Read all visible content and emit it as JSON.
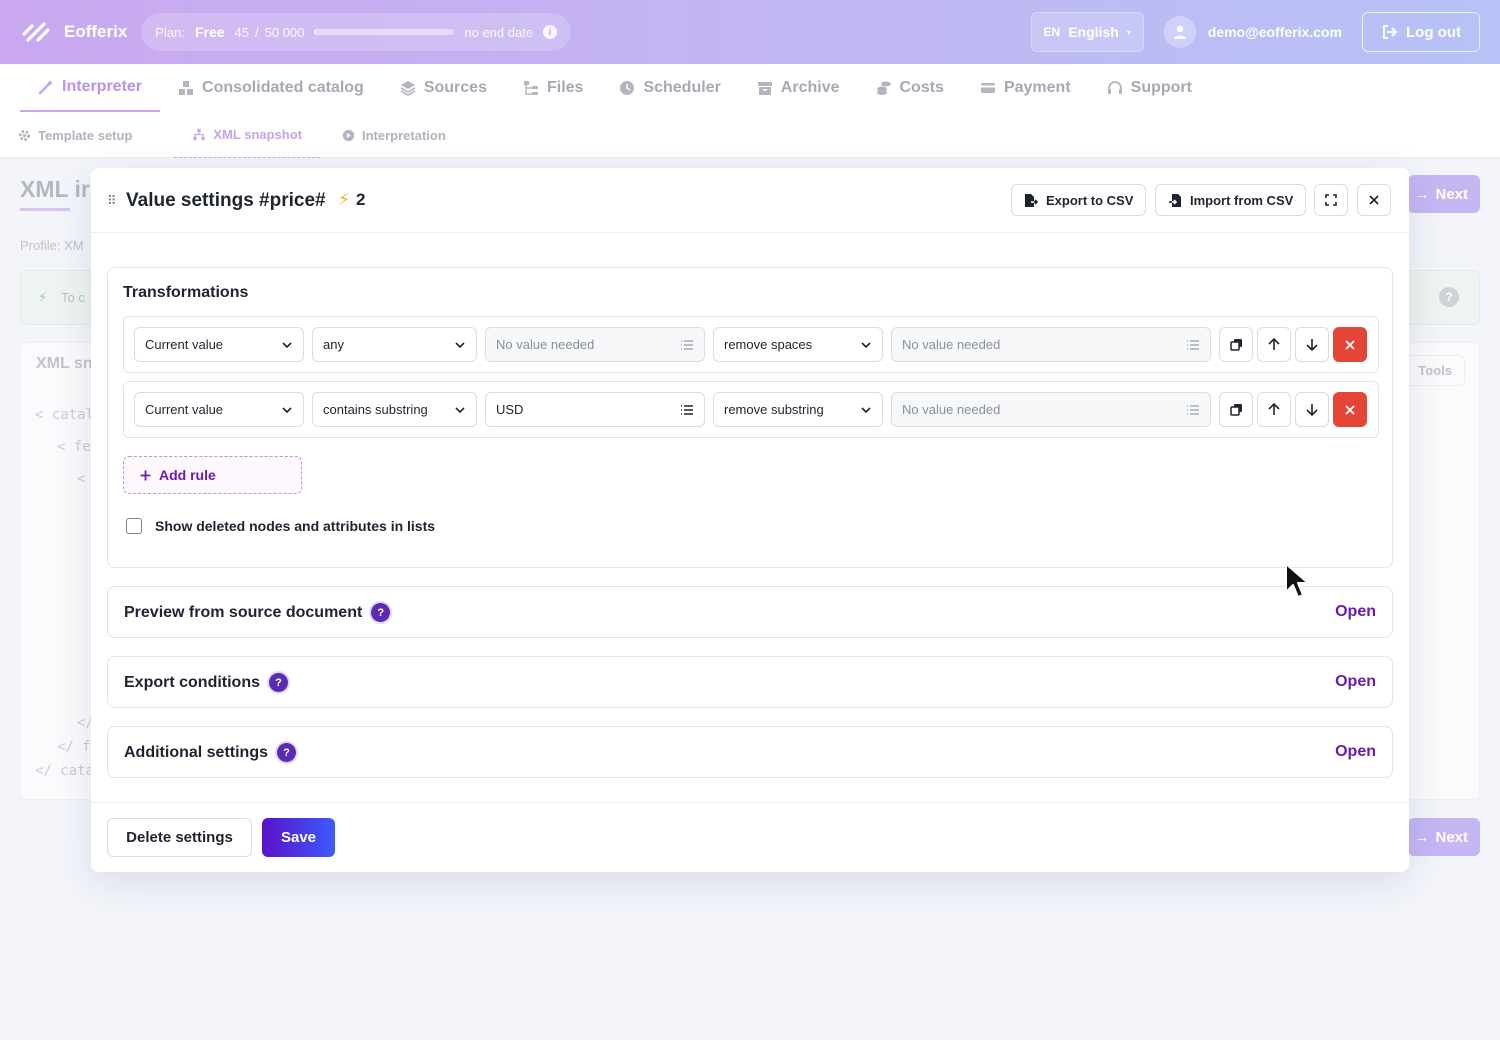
{
  "header": {
    "brand": "Eofferix",
    "plan_label": "Plan:",
    "plan_name": "Free",
    "usage_used": "45",
    "usage_sep": "/",
    "usage_total": "50 000",
    "usage_fraction": 0.0009,
    "plan_end": "no end date",
    "lang_code": "EN",
    "lang_name": "English",
    "user_email": "demo@eofferix.com",
    "logout_label": "Log out"
  },
  "nav": {
    "tabs": [
      {
        "label": "Interpreter",
        "icon": "magic-wand-icon"
      },
      {
        "label": "Consolidated catalog",
        "icon": "boxes-icon"
      },
      {
        "label": "Sources",
        "icon": "layers-icon"
      },
      {
        "label": "Files",
        "icon": "folder-tree-icon"
      },
      {
        "label": "Scheduler",
        "icon": "clock-icon"
      },
      {
        "label": "Archive",
        "icon": "archive-icon"
      },
      {
        "label": "Costs",
        "icon": "coins-icon"
      },
      {
        "label": "Payment",
        "icon": "credit-card-icon"
      },
      {
        "label": "Support",
        "icon": "headset-icon"
      }
    ],
    "sub_tabs": [
      {
        "label": "Template setup",
        "icon": "gear-icon"
      },
      {
        "label": "XML snapshot",
        "icon": "sitemap-icon"
      },
      {
        "label": "Interpretation",
        "icon": "play-icon"
      }
    ]
  },
  "background": {
    "page_title": "XML ir",
    "profile": "Profile: XM",
    "alert": "To c",
    "panel_title": "XML sn",
    "tools_label": "Tools",
    "next_label": "Next",
    "code_lines": [
      "< catal",
      "< fee",
      "< ",
      "</",
      "</ fe",
      "</ cata"
    ]
  },
  "modal": {
    "title": "Value settings #price#",
    "bolt": "⚡",
    "count": "2",
    "export_label": "Export to CSV",
    "import_label": "Import from CSV",
    "transformations_title": "Transformations",
    "rules": [
      {
        "source": "Current value",
        "condition": "any",
        "condition_value": "No value needed",
        "action": "remove spaces",
        "action_value": "No value needed"
      },
      {
        "source": "Current value",
        "condition": "contains substring",
        "condition_value": "USD",
        "action": "remove substring",
        "action_value": "No value needed"
      }
    ],
    "add_rule_label": "Add rule",
    "show_deleted_label": "Show deleted nodes and attributes in lists",
    "sections": [
      {
        "title": "Preview from source document",
        "open_label": "Open"
      },
      {
        "title": "Export conditions",
        "open_label": "Open"
      },
      {
        "title": "Additional settings",
        "open_label": "Open"
      }
    ],
    "delete_label": "Delete settings",
    "save_label": "Save"
  },
  "colors": {
    "accent": "#6a1bb3",
    "danger": "#e54536",
    "brand_gradient_start": "#c9a8ef",
    "brand_gradient_end": "#b7c2f6"
  }
}
